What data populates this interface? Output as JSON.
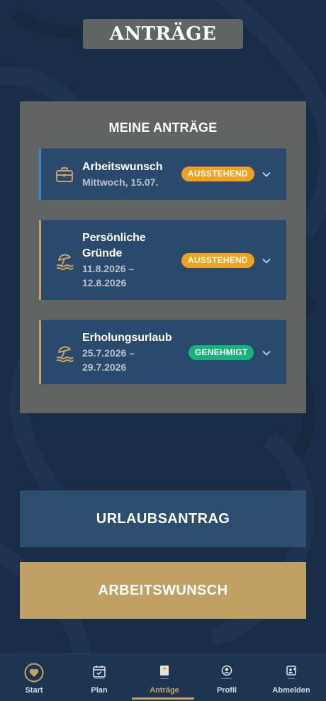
{
  "header": {
    "title": "ANTRÄGE"
  },
  "panel": {
    "title": "MEINE ANTRÄGE",
    "requests": [
      {
        "type": "Arbeitswunsch",
        "date_line1": "Mittwoch, 15.07.",
        "date_line2": "",
        "status": "AUSSTEHEND",
        "icon": "briefcase-icon",
        "accent": "#3f86d6"
      },
      {
        "type_line1": "Persönliche",
        "type_line2": "Gründe",
        "date_line1": "11.8.2026 –",
        "date_line2": "12.8.2026",
        "status": "AUSSTEHEND",
        "icon": "beach-icon",
        "accent": "#c8a263"
      },
      {
        "type": "Erholungsurlaub",
        "date_line1": "25.7.2026 –",
        "date_line2": "29.7.2026",
        "status": "GENEHMIGT",
        "icon": "beach-icon",
        "accent": "#c8a263"
      }
    ]
  },
  "actions": {
    "vacation_request_label": "URLAUBSANTRAG",
    "work_wish_label": "ARBEITSWUNSCH"
  },
  "nav": {
    "items": [
      {
        "label": "Start",
        "icon": "heart-icon"
      },
      {
        "label": "Plan",
        "icon": "calendar-icon"
      },
      {
        "label": "Anträge",
        "icon": "document-icon",
        "active": true
      },
      {
        "label": "Profil",
        "icon": "profile-icon"
      },
      {
        "label": "Abmelden",
        "icon": "logout-icon"
      }
    ]
  },
  "colors": {
    "background": "#1a2d48",
    "panel": "#606563",
    "card": "#2a4a6d",
    "gold": "#c8a263",
    "pending": "#f0a21c",
    "approved": "#16b47c"
  }
}
